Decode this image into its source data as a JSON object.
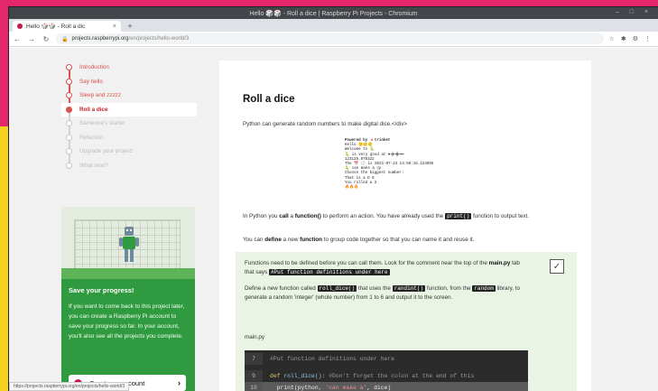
{
  "browser": {
    "window_title": "Hello 🎲🎲 - Roll a dice | Raspberry Pi Projects - Chromium",
    "tab_label": "Hello 🎲🎲 - Roll a dic",
    "tab_close": "×",
    "new_tab": "+",
    "url_host": "projects.raspberrypi.org",
    "url_path": "/en/projects/hello-world/3",
    "status_url": "https://projects.raspberrypi.org/en/projects/hello-world/3"
  },
  "steps": [
    {
      "label": "Introduction",
      "state": "done"
    },
    {
      "label": "Say hello",
      "state": "done"
    },
    {
      "label": "Sleep and zzzzz",
      "state": "done"
    },
    {
      "label": "Roll a dice",
      "state": "current"
    },
    {
      "label": "Sameone's starter",
      "state": "future"
    },
    {
      "label": "Refection",
      "state": "future"
    },
    {
      "label": "Upgrade your project",
      "state": "future"
    },
    {
      "label": "What next?",
      "state": "future"
    }
  ],
  "card": {
    "title": "Save your progress!",
    "text": "If you want to come back to this project later, you can create a Raspberry Pi account to save your progress so far. In your account, you'll also see all the projects you complete.",
    "button": "Create an account",
    "arrow": "›"
  },
  "main": {
    "title": "Roll a dice",
    "intro": "Python can generate random numbers to make digital dice.</div>",
    "call_pre": "In Python you ",
    "call_b1": "call",
    "call_mid": " a ",
    "call_b2": "function()",
    "call_mid2": " to perform an action. You have already used the ",
    "call_code": "print()",
    "call_post": " function to output text.",
    "define_pre": "You can ",
    "define_b1": "define",
    "define_mid": " a new ",
    "define_b2": "function",
    "define_post": " to group code together so that you can name it and reuse it."
  },
  "trinket": {
    "header": "Powered by 🔺trinket",
    "lines": [
      "Hello 🙂🙂🙂",
      "Welcome to 🐍",
      "🐍 is very good at ✖➗➕➖",
      "123125.876322",
      "The 📅 🕐 is 2021-07-23 13:59:16.124955",
      "🐍 can make a 🎲",
      "Choose the biggest number:",
      "That is a D 6",
      "You rolled a 3",
      "🔥🔥🔥"
    ]
  },
  "task": {
    "p1_pre": "Functions need to be defined before you can call them. Look for the comment near the top of the ",
    "p1_b": "main.py",
    "p1_mid": " tab that says ",
    "p1_code": "#Put function definitions under here",
    "p2_pre": "Define a new function called ",
    "p2_code1": "roll_dice()",
    "p2_mid1": " that uses the ",
    "p2_code2": "randint()",
    "p2_mid2": " function, from the ",
    "p2_code3": "random",
    "p2_post": " library, to generate a random 'integer' (whole number) from 1 to 6 and output it to the screen.",
    "filename": "main.py",
    "checkmark": "✓"
  },
  "code": [
    {
      "num": "7",
      "comment": "#Put function definitions under here"
    },
    {
      "num": "9",
      "kw": "def ",
      "fn": "roll_dice():",
      "comment": " #Don't forget the colon at the end of this"
    },
    {
      "num": "10",
      "plain": "  print(python, ",
      "str": "'can make a'",
      "plain2": ", dice)"
    }
  ]
}
